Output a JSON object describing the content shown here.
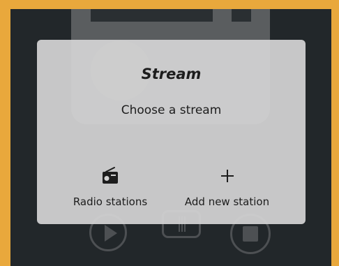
{
  "dialog": {
    "title": "Stream",
    "subtitle": "Choose a stream",
    "options": [
      {
        "label": "Radio stations",
        "icon": "radio-icon"
      },
      {
        "label": "Add new station",
        "icon": "plus-icon"
      }
    ]
  },
  "colors": {
    "frame": "#e9a83c",
    "background": "#22272a",
    "dialog": "#d4d4d4",
    "text": "#1d1d1d"
  }
}
